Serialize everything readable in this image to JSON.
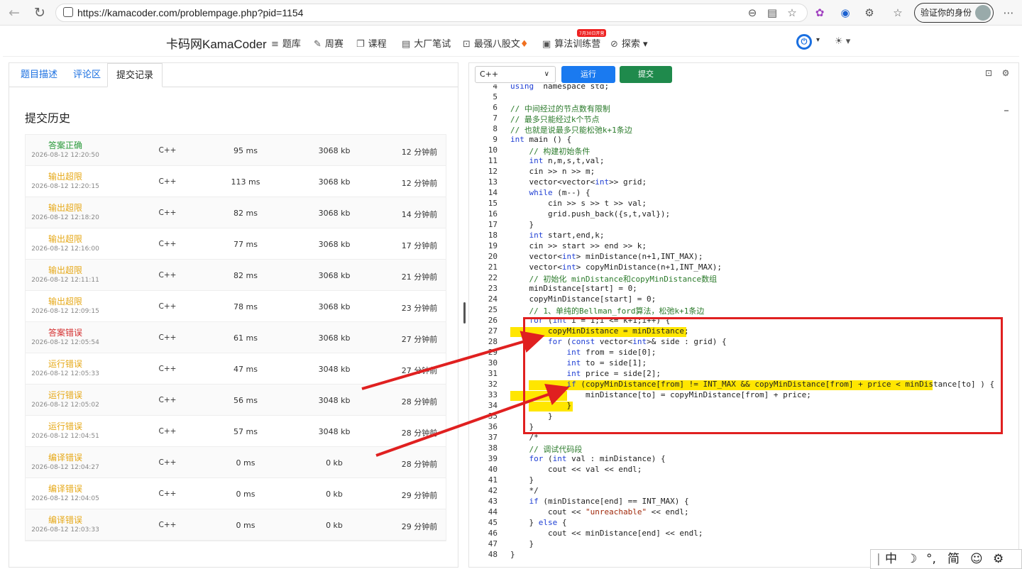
{
  "browser": {
    "url": "https://kamacoder.com/problempage.php?pid=1154",
    "verify_label": "验证你的身份"
  },
  "navbar": {
    "brand": "卡码网KamaCoder",
    "items": [
      "题库",
      "周赛",
      "课程",
      "大厂笔试",
      "最强八股文",
      "算法训练营",
      "探索"
    ],
    "badge": "7月30日开营"
  },
  "left": {
    "tabs": [
      "题目描述",
      "评论区",
      "提交记录"
    ],
    "active_tab": 2,
    "history_title": "提交历史",
    "submissions": [
      {
        "status": "答案正确",
        "kind": "ok",
        "time": "2026-08-12 12:20:50",
        "lang": "C++",
        "runtime": "95 ms",
        "memory": "3068 kb",
        "ago": "12 分钟前"
      },
      {
        "status": "输出超限",
        "kind": "warn",
        "time": "2026-08-12 12:20:15",
        "lang": "C++",
        "runtime": "113 ms",
        "memory": "3068 kb",
        "ago": "12 分钟前"
      },
      {
        "status": "输出超限",
        "kind": "warn",
        "time": "2026-08-12 12:18:20",
        "lang": "C++",
        "runtime": "82 ms",
        "memory": "3068 kb",
        "ago": "14 分钟前"
      },
      {
        "status": "输出超限",
        "kind": "warn",
        "time": "2026-08-12 12:16:00",
        "lang": "C++",
        "runtime": "77 ms",
        "memory": "3068 kb",
        "ago": "17 分钟前"
      },
      {
        "status": "输出超限",
        "kind": "warn",
        "time": "2026-08-12 12:11:11",
        "lang": "C++",
        "runtime": "82 ms",
        "memory": "3068 kb",
        "ago": "21 分钟前"
      },
      {
        "status": "输出超限",
        "kind": "warn",
        "time": "2026-08-12 12:09:15",
        "lang": "C++",
        "runtime": "78 ms",
        "memory": "3068 kb",
        "ago": "23 分钟前"
      },
      {
        "status": "答案错误",
        "kind": "err",
        "time": "2026-08-12 12:05:54",
        "lang": "C++",
        "runtime": "61 ms",
        "memory": "3068 kb",
        "ago": "27 分钟前"
      },
      {
        "status": "运行错误",
        "kind": "warn",
        "time": "2026-08-12 12:05:33",
        "lang": "C++",
        "runtime": "47 ms",
        "memory": "3048 kb",
        "ago": "27 分钟前"
      },
      {
        "status": "运行错误",
        "kind": "warn",
        "time": "2026-08-12 12:05:02",
        "lang": "C++",
        "runtime": "56 ms",
        "memory": "3048 kb",
        "ago": "28 分钟前"
      },
      {
        "status": "运行错误",
        "kind": "warn",
        "time": "2026-08-12 12:04:51",
        "lang": "C++",
        "runtime": "57 ms",
        "memory": "3048 kb",
        "ago": "28 分钟前"
      },
      {
        "status": "编译错误",
        "kind": "warn",
        "time": "2026-08-12 12:04:27",
        "lang": "C++",
        "runtime": "0 ms",
        "memory": "0 kb",
        "ago": "28 分钟前"
      },
      {
        "status": "编译错误",
        "kind": "warn",
        "time": "2026-08-12 12:04:05",
        "lang": "C++",
        "runtime": "0 ms",
        "memory": "0 kb",
        "ago": "29 分钟前"
      },
      {
        "status": "编译错误",
        "kind": "warn",
        "time": "2026-08-12 12:03:33",
        "lang": "C++",
        "runtime": "0 ms",
        "memory": "0 kb",
        "ago": "29 分钟前"
      }
    ]
  },
  "editor": {
    "language": "C++",
    "run_label": "运行",
    "submit_label": "提交",
    "first_line": 4,
    "lines": [
      [
        [
          "kw",
          "using"
        ],
        [
          "",
          "  namespace std;"
        ]
      ],
      [],
      [
        [
          "cm",
          "// 中间经过的节点数有限制"
        ]
      ],
      [
        [
          "cm",
          "// 最多只能经过k个节点"
        ]
      ],
      [
        [
          "cm",
          "// 也就是说最多只能松弛k+1条边"
        ]
      ],
      [
        [
          "kw",
          "int"
        ],
        [
          "",
          " main () {"
        ]
      ],
      [
        [
          "",
          "    "
        ],
        [
          "cm",
          "// 构建初始条件"
        ]
      ],
      [
        [
          "",
          "    "
        ],
        [
          "kw",
          "int"
        ],
        [
          "",
          " n,m,s,t,val;"
        ]
      ],
      [
        [
          "",
          "    cin >> n >> m;"
        ]
      ],
      [
        [
          "",
          "    vector<vector<"
        ],
        [
          "kw",
          "int"
        ],
        [
          "",
          ">> grid;"
        ]
      ],
      [
        [
          "",
          "    "
        ],
        [
          "kw",
          "while"
        ],
        [
          "",
          " (m--) {"
        ]
      ],
      [
        [
          "",
          "        cin >> s >> t >> val;"
        ]
      ],
      [
        [
          "",
          "        grid.push_back({s,t,val});"
        ]
      ],
      [
        [
          "",
          "    }"
        ]
      ],
      [
        [
          "",
          "    "
        ],
        [
          "kw",
          "int"
        ],
        [
          "",
          " start,end,k;"
        ]
      ],
      [
        [
          "",
          "    cin >> start >> end >> k;"
        ]
      ],
      [
        [
          "",
          "    vector<"
        ],
        [
          "kw",
          "int"
        ],
        [
          "",
          "> minDistance(n+1,INT_MAX);"
        ]
      ],
      [
        [
          "",
          "    vector<"
        ],
        [
          "kw",
          "int"
        ],
        [
          "",
          "> copyMinDistance(n+1,INT_MAX);"
        ]
      ],
      [
        [
          "",
          "    "
        ],
        [
          "cm",
          "// 初始化 minDistance和copyMinDistance数组"
        ]
      ],
      [
        [
          "",
          "    minDistance[start] = 0;"
        ]
      ],
      [
        [
          "",
          "    copyMinDistance[start] = 0;"
        ]
      ],
      [
        [
          "",
          "    "
        ],
        [
          "cm",
          "// 1、单纯的Bellman_ford算法，松弛k+1条边"
        ]
      ],
      [
        [
          "",
          "    "
        ],
        [
          "kw",
          "for"
        ],
        [
          "",
          " ("
        ],
        [
          "kw",
          "int"
        ],
        [
          "",
          " i = 1;i <= k+1;i++) {"
        ]
      ],
      [
        [
          "",
          "        copyMinDistance = minDistance;"
        ]
      ],
      [
        [
          "",
          "        "
        ],
        [
          "kw",
          "for"
        ],
        [
          "",
          " ("
        ],
        [
          "kw",
          "const"
        ],
        [
          "",
          " vector<"
        ],
        [
          "kw",
          "int"
        ],
        [
          "",
          ">& side : grid) {"
        ]
      ],
      [
        [
          "",
          "            "
        ],
        [
          "kw",
          "int"
        ],
        [
          "",
          " from = side[0];"
        ]
      ],
      [
        [
          "",
          "            "
        ],
        [
          "kw",
          "int"
        ],
        [
          "",
          " to = side[1];"
        ]
      ],
      [
        [
          "",
          "            "
        ],
        [
          "kw",
          "int"
        ],
        [
          "",
          " price = side[2];"
        ]
      ],
      [
        [
          "",
          "            "
        ],
        [
          "kw",
          "if"
        ],
        [
          "",
          " (copyMinDistance[from] != INT_MAX && copyMinDistance[from] + price < minDistance[to] ) {"
        ]
      ],
      [
        [
          "",
          "                minDistance[to] = copyMinDistance[from] + price;"
        ]
      ],
      [
        [
          "",
          "            }"
        ]
      ],
      [
        [
          "",
          "        }"
        ]
      ],
      [
        [
          "",
          "    }"
        ]
      ],
      [
        [
          "",
          "    /*"
        ]
      ],
      [
        [
          "",
          "    "
        ],
        [
          "cm",
          "// 调试代码段"
        ]
      ],
      [
        [
          "",
          "    "
        ],
        [
          "kw",
          "for"
        ],
        [
          "",
          " ("
        ],
        [
          "kw",
          "int"
        ],
        [
          "",
          " val : minDistance) {"
        ]
      ],
      [
        [
          "",
          "        cout << val << endl;"
        ]
      ],
      [
        [
          "",
          "    }"
        ]
      ],
      [
        [
          "",
          "    */"
        ]
      ],
      [
        [
          "",
          "    "
        ],
        [
          "kw",
          "if"
        ],
        [
          "",
          " (minDistance[end] == INT_MAX) {"
        ]
      ],
      [
        [
          "",
          "        cout << "
        ],
        [
          "str",
          "\"unreachable\""
        ],
        [
          "",
          " << endl;"
        ]
      ],
      [
        [
          "",
          "    } "
        ],
        [
          "kw",
          "else"
        ],
        [
          "",
          " {"
        ]
      ],
      [
        [
          "",
          "        cout << minDistance[end] << endl;"
        ]
      ],
      [
        [
          "",
          "    }"
        ]
      ],
      [
        [
          "",
          "}"
        ]
      ]
    ]
  },
  "ime": {
    "chars": [
      "中",
      "☽",
      "°,",
      "简",
      "☺",
      "⚙"
    ]
  },
  "colors": {
    "accent": "#1a7af0",
    "submit": "#1f8a4c",
    "highlight": "#ffe600",
    "annotation": "#e02020",
    "keyword": "#1f3fd4",
    "comment": "#2a7a2a",
    "string": "#a0280a"
  }
}
